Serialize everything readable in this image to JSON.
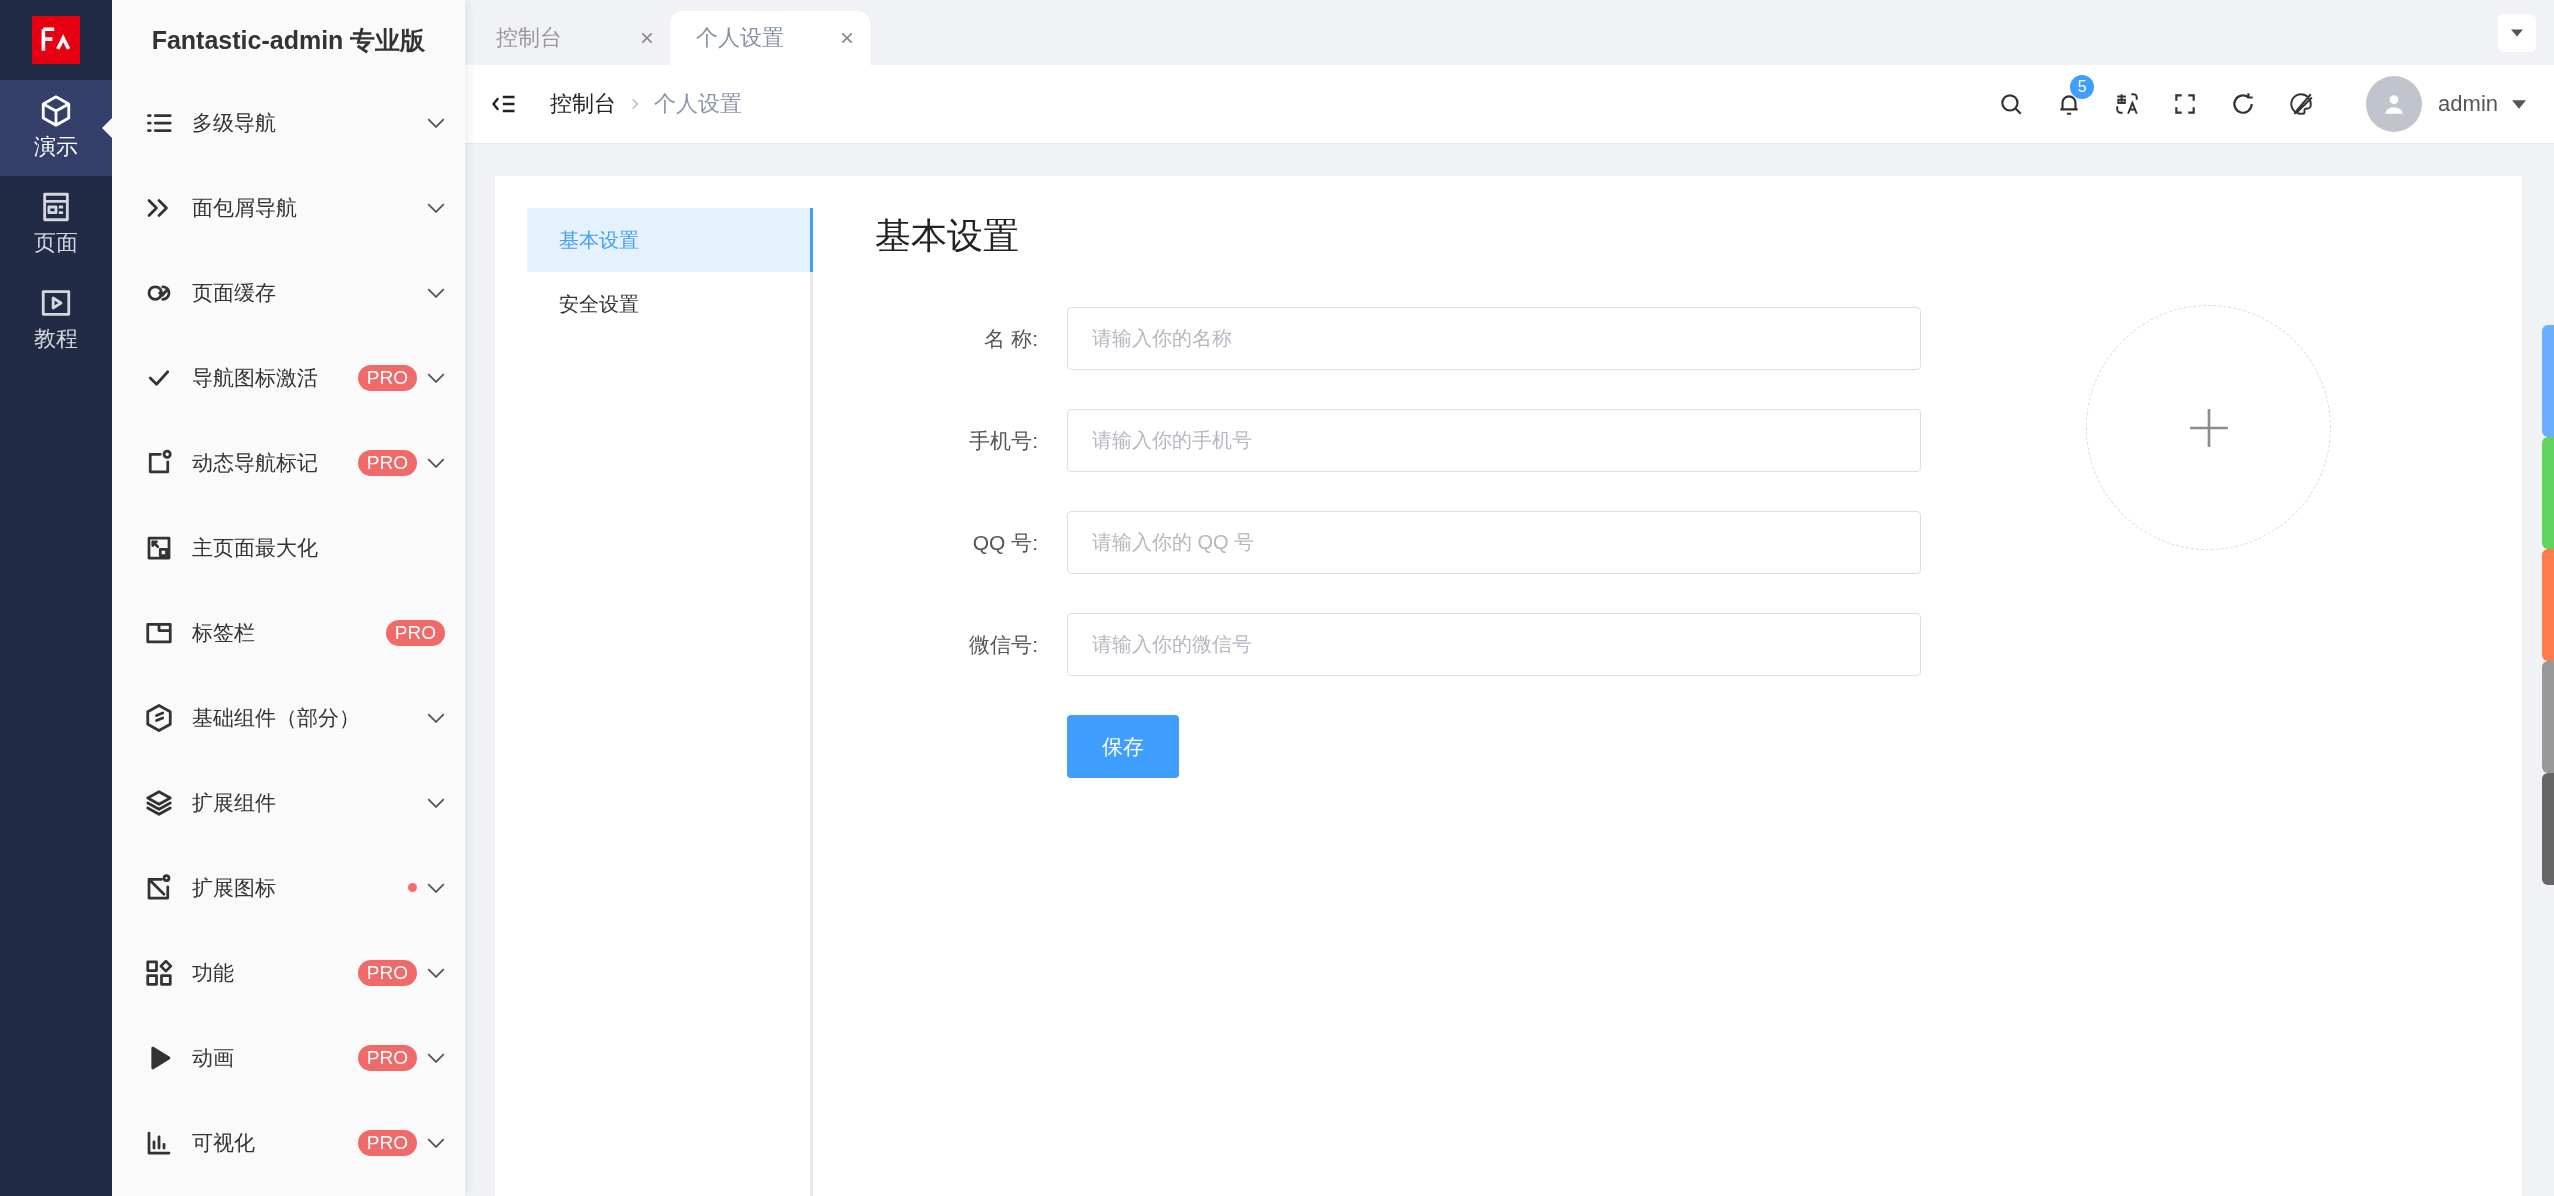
{
  "rail": {
    "items": [
      {
        "label": "演示",
        "selected": true
      },
      {
        "label": "页面",
        "selected": false
      },
      {
        "label": "教程",
        "selected": false
      }
    ]
  },
  "sidebar": {
    "title": "Fantastic-admin 专业版",
    "items": [
      {
        "label": "多级导航",
        "dot": false,
        "expandable": true
      },
      {
        "label": "面包屑导航",
        "dot": false,
        "expandable": true
      },
      {
        "label": "页面缓存",
        "dot": false,
        "expandable": true
      },
      {
        "label": "导航图标激活",
        "badge": "PRO",
        "dot": false,
        "expandable": true
      },
      {
        "label": "动态导航标记",
        "badge": "PRO",
        "dot": false,
        "expandable": true
      },
      {
        "label": "主页面最大化",
        "dot": false,
        "expandable": false
      },
      {
        "label": "标签栏",
        "badge": "PRO",
        "dot": false,
        "expandable": false
      },
      {
        "label": "基础组件（部分）",
        "dot": false,
        "expandable": true
      },
      {
        "label": "扩展组件",
        "dot": false,
        "expandable": true
      },
      {
        "label": "扩展图标",
        "dot": true,
        "expandable": true
      },
      {
        "label": "功能",
        "badge": "PRO",
        "dot": false,
        "expandable": true
      },
      {
        "label": "动画",
        "badge": "PRO",
        "dot": false,
        "expandable": true
      },
      {
        "label": "可视化",
        "badge": "PRO",
        "dot": false,
        "expandable": true
      }
    ]
  },
  "tabs": [
    {
      "label": "控制台",
      "selected": false
    },
    {
      "label": "个人设置",
      "selected": true
    }
  ],
  "breadcrumb": [
    "控制台",
    "个人设置"
  ],
  "header": {
    "notification_count": "5",
    "user": "admin"
  },
  "settings_menu": [
    {
      "label": "基本设置",
      "selected": true
    },
    {
      "label": "安全设置",
      "selected": false
    }
  ],
  "form": {
    "title": "基本设置",
    "fields": [
      {
        "label": "名 称:",
        "placeholder": "请输入你的名称"
      },
      {
        "label": "手机号:",
        "placeholder": "请输入你的手机号"
      },
      {
        "label": "QQ 号:",
        "placeholder": "请输入你的 QQ 号"
      },
      {
        "label": "微信号:",
        "placeholder": "请输入你的微信号"
      }
    ],
    "save_button": "保存"
  },
  "theme_swatches": [
    {
      "color": "#6aaeff"
    },
    {
      "color": "#5fd45f"
    },
    {
      "color": "#ff7a4d"
    },
    {
      "color": "#999999"
    },
    {
      "color": "#666666"
    }
  ]
}
